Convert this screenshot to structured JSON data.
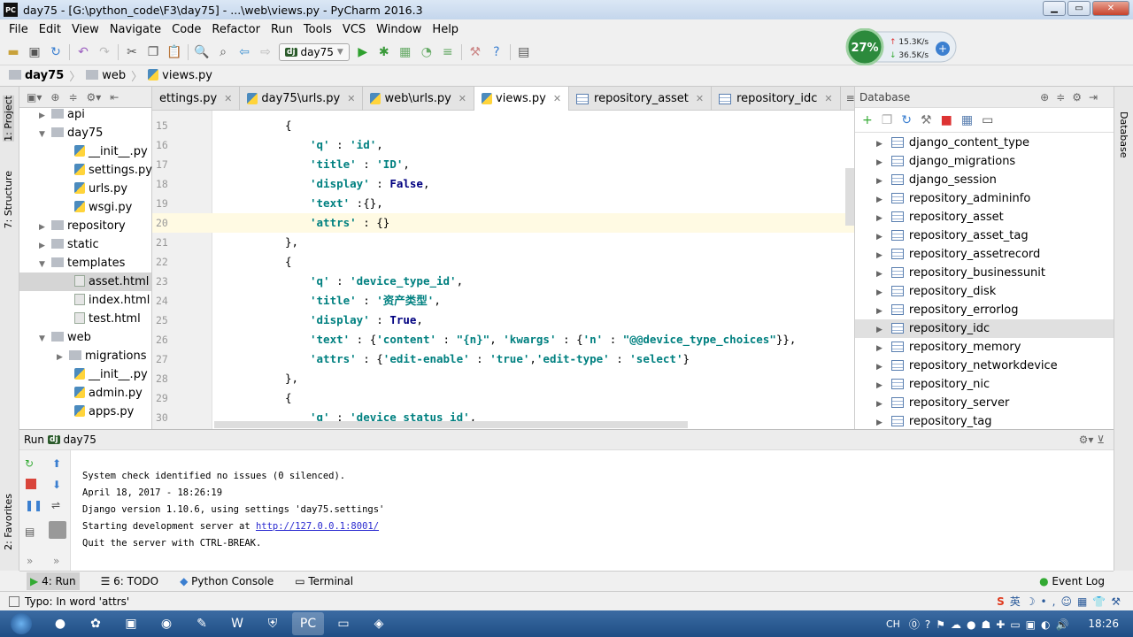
{
  "window": {
    "title": "day75 - [G:\\python_code\\F3\\day75] - ...\\web\\views.py - PyCharm 2016.3",
    "app_icon": "PC"
  },
  "menu": [
    "File",
    "Edit",
    "View",
    "Navigate",
    "Code",
    "Refactor",
    "Run",
    "Tools",
    "VCS",
    "Window",
    "Help"
  ],
  "toolbar": {
    "run_config": "day75"
  },
  "network_widget": {
    "cpu": "27%",
    "up": "15.3K/s",
    "down": "36.5K/s"
  },
  "breadcrumb": [
    "day75",
    "web",
    "views.py"
  ],
  "left_strip": [
    "1: Project",
    "7: Structure",
    "2: Favorites"
  ],
  "right_strip": [
    "Database"
  ],
  "project_tree": [
    {
      "label": "api",
      "type": "folder",
      "level": 1,
      "arrow": "▶"
    },
    {
      "label": "day75",
      "type": "folder",
      "level": 1,
      "arrow": "▼"
    },
    {
      "label": "__init__.py",
      "type": "py",
      "level": 2
    },
    {
      "label": "settings.py",
      "type": "py",
      "level": 2
    },
    {
      "label": "urls.py",
      "type": "py",
      "level": 2
    },
    {
      "label": "wsgi.py",
      "type": "py",
      "level": 2
    },
    {
      "label": "repository",
      "type": "folder",
      "level": 1,
      "arrow": "▶"
    },
    {
      "label": "static",
      "type": "folder",
      "level": 1,
      "arrow": "▶"
    },
    {
      "label": "templates",
      "type": "folder",
      "level": 1,
      "arrow": "▼"
    },
    {
      "label": "asset.html",
      "type": "html",
      "level": 2,
      "selected": true
    },
    {
      "label": "index.html",
      "type": "html",
      "level": 2
    },
    {
      "label": "test.html",
      "type": "html",
      "level": 2
    },
    {
      "label": "web",
      "type": "folder",
      "level": 1,
      "arrow": "▼"
    },
    {
      "label": "migrations",
      "type": "folder",
      "level": 2,
      "arrow": "▶"
    },
    {
      "label": "__init__.py",
      "type": "py",
      "level": 2
    },
    {
      "label": "admin.py",
      "type": "py",
      "level": 2
    },
    {
      "label": "apps.py",
      "type": "py",
      "level": 2
    }
  ],
  "editor_tabs": [
    {
      "label": "ettings.py",
      "icon": "py"
    },
    {
      "label": "day75\\urls.py",
      "icon": "py"
    },
    {
      "label": "web\\urls.py",
      "icon": "py"
    },
    {
      "label": "views.py",
      "icon": "py",
      "active": true
    },
    {
      "label": "repository_asset",
      "icon": "table"
    },
    {
      "label": "repository_idc",
      "icon": "table"
    }
  ],
  "tabs_overflow": "≡4",
  "code_lines": [
    {
      "n": "15",
      "indent": 4,
      "tokens": [
        [
          "p",
          "{"
        ]
      ]
    },
    {
      "n": "16",
      "indent": 6,
      "tokens": [
        [
          "s",
          "'q'"
        ],
        [
          "p",
          " : "
        ],
        [
          "s",
          "'id'"
        ],
        [
          "p",
          ","
        ]
      ]
    },
    {
      "n": "17",
      "indent": 6,
      "tokens": [
        [
          "s",
          "'title'"
        ],
        [
          "p",
          " : "
        ],
        [
          "s",
          "'ID'"
        ],
        [
          "p",
          ","
        ]
      ]
    },
    {
      "n": "18",
      "indent": 6,
      "tokens": [
        [
          "s",
          "'display'"
        ],
        [
          "p",
          " : "
        ],
        [
          "b",
          "False"
        ],
        [
          "p",
          ","
        ]
      ]
    },
    {
      "n": "19",
      "indent": 6,
      "tokens": [
        [
          "s",
          "'text'"
        ],
        [
          "p",
          " :{},"
        ]
      ]
    },
    {
      "n": "20",
      "indent": 6,
      "current": true,
      "tokens": [
        [
          "s",
          "'attrs'"
        ],
        [
          "p",
          " : {}"
        ]
      ]
    },
    {
      "n": "21",
      "indent": 4,
      "tokens": [
        [
          "p",
          "},"
        ]
      ]
    },
    {
      "n": "22",
      "indent": 4,
      "tokens": [
        [
          "p",
          "{"
        ]
      ]
    },
    {
      "n": "23",
      "indent": 6,
      "tokens": [
        [
          "s",
          "'q'"
        ],
        [
          "p",
          " : "
        ],
        [
          "s",
          "'device_type_id'"
        ],
        [
          "p",
          ","
        ]
      ]
    },
    {
      "n": "24",
      "indent": 6,
      "tokens": [
        [
          "s",
          "'title'"
        ],
        [
          "p",
          " : "
        ],
        [
          "s",
          "'资产类型'"
        ],
        [
          "p",
          ","
        ]
      ]
    },
    {
      "n": "25",
      "indent": 6,
      "tokens": [
        [
          "s",
          "'display'"
        ],
        [
          "p",
          " : "
        ],
        [
          "b",
          "True"
        ],
        [
          "p",
          ","
        ]
      ]
    },
    {
      "n": "26",
      "indent": 6,
      "tokens": [
        [
          "s",
          "'text'"
        ],
        [
          "p",
          " : {"
        ],
        [
          "s",
          "'content'"
        ],
        [
          "p",
          " : "
        ],
        [
          "s",
          "\"{n}\""
        ],
        [
          "p",
          ", "
        ],
        [
          "s",
          "'kwargs'"
        ],
        [
          "p",
          " : {"
        ],
        [
          "s",
          "'n'"
        ],
        [
          "p",
          " : "
        ],
        [
          "s",
          "\"@@device_type_choices\""
        ],
        [
          "p",
          "}},"
        ]
      ]
    },
    {
      "n": "27",
      "indent": 6,
      "tokens": [
        [
          "s",
          "'attrs'"
        ],
        [
          "p",
          " : {"
        ],
        [
          "s",
          "'edit-enable'"
        ],
        [
          "p",
          " : "
        ],
        [
          "s",
          "'true'"
        ],
        [
          "p",
          ","
        ],
        [
          "s",
          "'edit-type'"
        ],
        [
          "p",
          " : "
        ],
        [
          "s",
          "'select'"
        ],
        [
          "p",
          "}"
        ]
      ]
    },
    {
      "n": "28",
      "indent": 4,
      "tokens": [
        [
          "p",
          "},"
        ]
      ]
    },
    {
      "n": "29",
      "indent": 4,
      "tokens": [
        [
          "p",
          "{"
        ]
      ]
    },
    {
      "n": "30",
      "indent": 6,
      "tokens": [
        [
          "s",
          "'q'"
        ],
        [
          "p",
          " : "
        ],
        [
          "s",
          "'device_status_id'"
        ],
        [
          "p",
          ","
        ]
      ]
    }
  ],
  "database": {
    "title": "Database",
    "tables": [
      "django_content_type",
      "django_migrations",
      "django_session",
      "repository_admininfo",
      "repository_asset",
      "repository_asset_tag",
      "repository_assetrecord",
      "repository_businessunit",
      "repository_disk",
      "repository_errorlog",
      "repository_idc",
      "repository_memory",
      "repository_networkdevice",
      "repository_nic",
      "repository_server",
      "repository_tag"
    ],
    "selected": "repository_idc"
  },
  "run": {
    "label": "Run",
    "config": "day75",
    "console": [
      "System check identified no issues (0 silenced).",
      "April 18, 2017 - 18:26:19",
      "Django version 1.10.6, using settings 'day75.settings'",
      "Starting development server at "
    ],
    "url": "http://127.0.0.1:8001/",
    "quit": "Quit the server with CTRL-BREAK."
  },
  "bottom_tabs": [
    "4: Run",
    "6: TODO",
    "Python Console",
    "Terminal"
  ],
  "event_log": "Event Log",
  "status": "Typo: In word 'attrs'",
  "taskbar": {
    "time": "18:26",
    "lang": "CH"
  }
}
